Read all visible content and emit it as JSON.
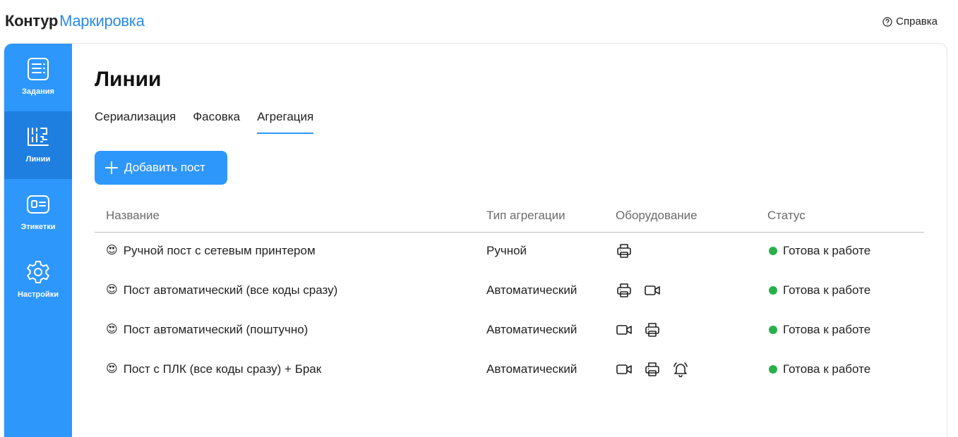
{
  "header": {
    "logo_part1": "Контур",
    "logo_part2": "Маркировка",
    "help_label": "Справка",
    "help_icon": "question-circle-icon"
  },
  "colors": {
    "accent": "#2e97fc",
    "sidebar_active": "#1f7fe0",
    "logo_accent": "#2b8ae8",
    "status_ok": "#2ab04a"
  },
  "sidebar": {
    "items": [
      {
        "label": "Задания",
        "icon": "tasks-list-icon",
        "active": false
      },
      {
        "label": "Линии",
        "icon": "lines-qr-icon",
        "active": true
      },
      {
        "label": "Этикетки",
        "icon": "label-icon",
        "active": false
      },
      {
        "label": "Настройки",
        "icon": "gear-icon",
        "active": false
      }
    ]
  },
  "page": {
    "title": "Линии",
    "tabs": [
      {
        "label": "Сериализация",
        "active": false
      },
      {
        "label": "Фасовка",
        "active": false
      },
      {
        "label": "Агрегация",
        "active": true
      }
    ],
    "add_button": "Добавить пост"
  },
  "table": {
    "columns": [
      "Название",
      "Тип агрегации",
      "Оборудование",
      "Статус"
    ],
    "rows": [
      {
        "emoji": "😍",
        "name": "Ручной пост с сетевым принтером",
        "type": "Ручной",
        "equipment": [
          "printer-icon"
        ],
        "status": "Готова к работе"
      },
      {
        "emoji": "😍",
        "name": "Пост автоматический (все коды сразу)",
        "type": "Автоматический",
        "equipment": [
          "printer-icon",
          "camera-icon"
        ],
        "status": "Готова к работе"
      },
      {
        "emoji": "😍",
        "name": "Пост автоматический (поштучно)",
        "type": "Автоматический",
        "equipment": [
          "camera-icon",
          "printer-icon"
        ],
        "status": "Готова к работе"
      },
      {
        "emoji": "😍",
        "name": "Пост с ПЛК (все коды сразу) + Брак",
        "type": "Автоматический",
        "equipment": [
          "camera-icon",
          "printer-icon",
          "bell-icon"
        ],
        "status": "Готова к работе"
      }
    ]
  }
}
